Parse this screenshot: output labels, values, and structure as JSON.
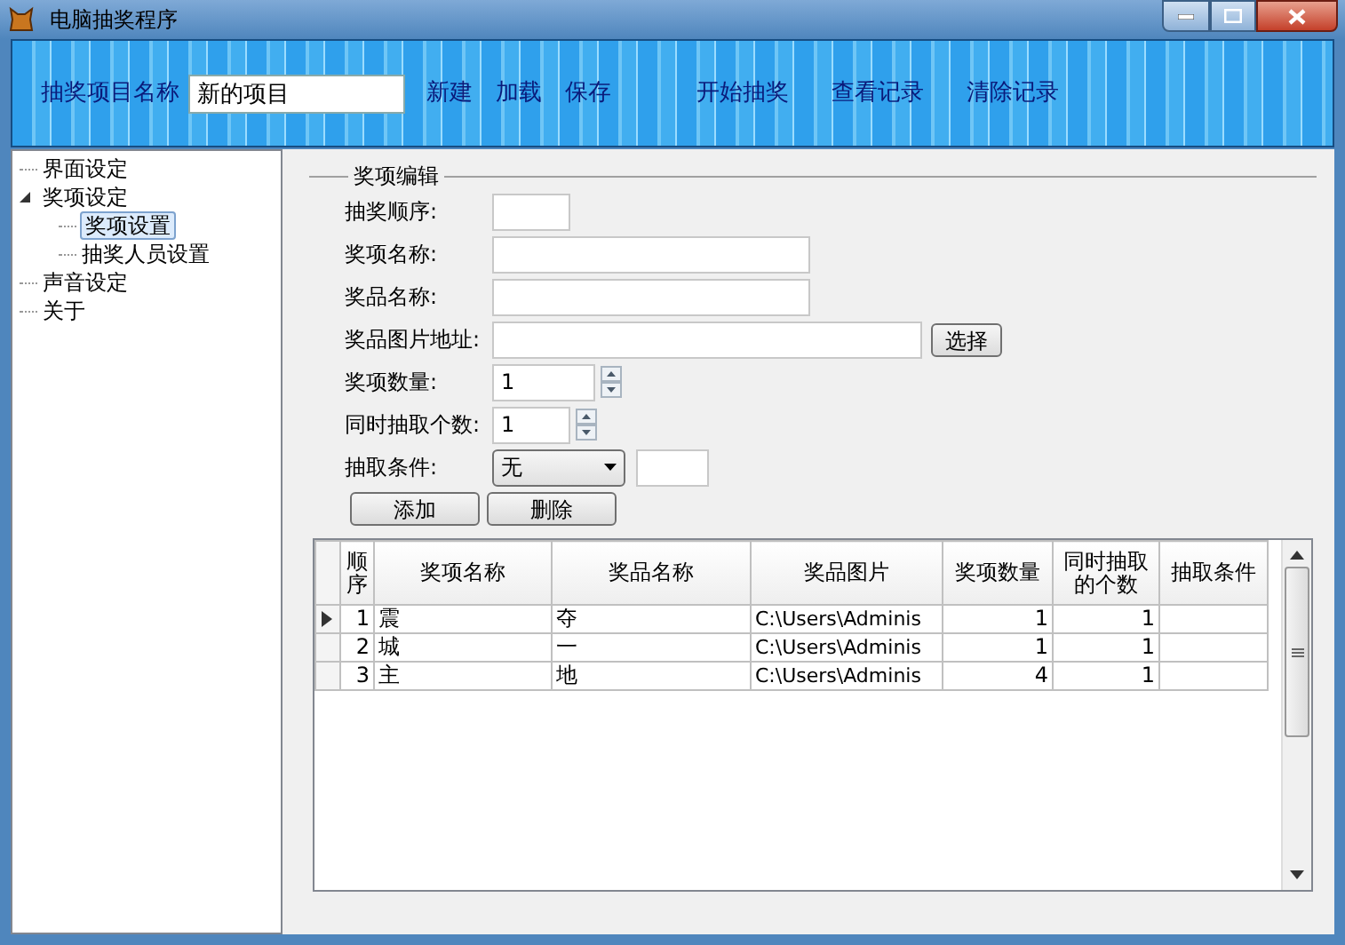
{
  "window": {
    "title": "电脑抽奖程序"
  },
  "toolbar": {
    "project_label": "抽奖项目名称",
    "project_name": "新的项目",
    "actions": [
      {
        "label": "新建"
      },
      {
        "label": "加载"
      },
      {
        "label": "保存"
      },
      {
        "label": "开始抽奖"
      },
      {
        "label": "查看记录"
      },
      {
        "label": "清除记录"
      }
    ]
  },
  "tree": [
    {
      "label": "界面设定",
      "selected": false
    },
    {
      "label": "奖项设定",
      "selected": false,
      "expanded": true,
      "children": [
        {
          "label": "奖项设置",
          "selected": true
        },
        {
          "label": "抽奖人员设置",
          "selected": false
        }
      ]
    },
    {
      "label": "声音设定",
      "selected": false
    },
    {
      "label": "关于",
      "selected": false
    }
  ],
  "form": {
    "title": "奖项编辑",
    "fields": [
      {
        "kind": "text",
        "label": "抽奖顺序:"
      },
      {
        "kind": "text",
        "label": "奖项名称:"
      },
      {
        "kind": "text",
        "label": "奖品名称:"
      },
      {
        "kind": "file",
        "label": "奖品图片地址:",
        "button": "选择"
      },
      {
        "kind": "spinner",
        "label": "奖项数量:",
        "value": "1"
      },
      {
        "kind": "spinner",
        "label": "同时抽取个数:",
        "value": "1"
      },
      {
        "kind": "select",
        "label": "抽取条件:",
        "value": "无"
      }
    ],
    "buttons": [
      "添加",
      "删除"
    ]
  },
  "grid": {
    "columns": [
      "顺序",
      "奖项名称",
      "奖品名称",
      "奖品图片",
      "奖项数量",
      "同时抽取的个数",
      "抽取条件"
    ],
    "rows": [
      {
        "current": true,
        "cells": [
          "1",
          "震",
          "夺",
          "C:\\Users\\Adminis",
          "1",
          "1",
          ""
        ]
      },
      {
        "current": false,
        "cells": [
          "2",
          "城",
          "一",
          "C:\\Users\\Adminis",
          "1",
          "1",
          ""
        ]
      },
      {
        "current": false,
        "cells": [
          "3",
          "主",
          "地",
          "C:\\Users\\Adminis",
          "4",
          "1",
          ""
        ]
      }
    ]
  }
}
